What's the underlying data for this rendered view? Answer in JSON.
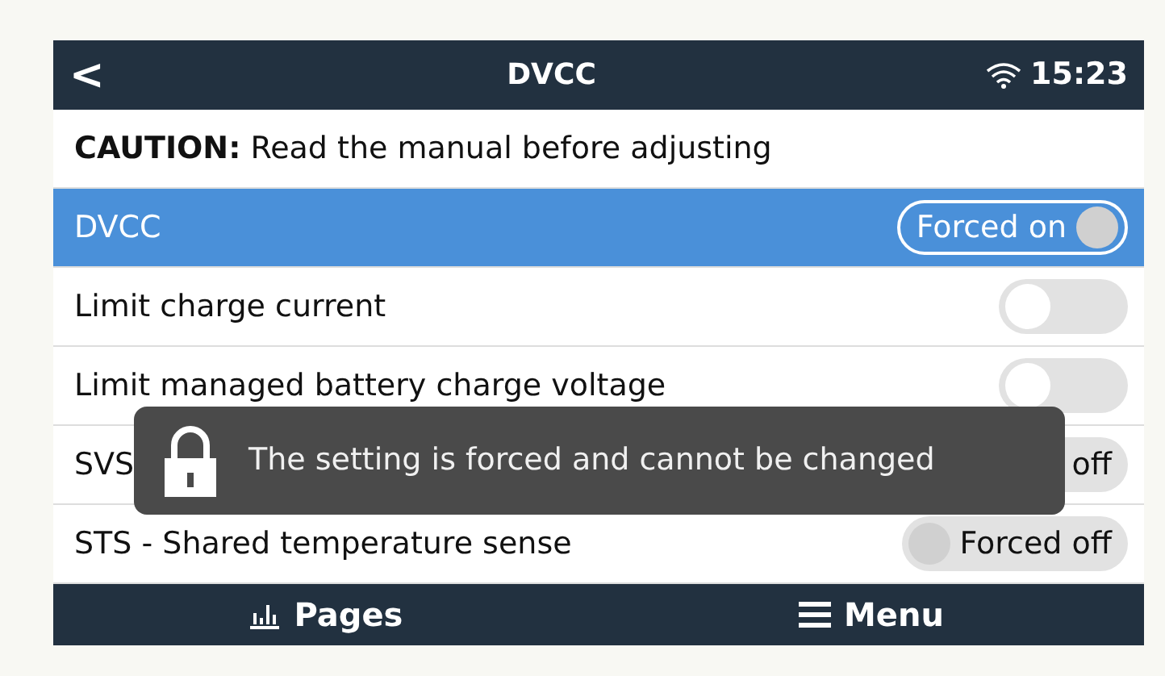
{
  "header": {
    "back": "<",
    "title": "DVCC",
    "time": "15:23"
  },
  "caution": "**CAUTION:** Read the manual before adjusting",
  "settings": [
    {
      "label": "DVCC",
      "selected": true,
      "control": {
        "kind": "forced",
        "on": true,
        "text": "Forced on"
      }
    },
    {
      "label": "Limit charge current",
      "selected": false,
      "control": {
        "kind": "switch",
        "on": false
      }
    },
    {
      "label": "Limit managed battery charge voltage",
      "selected": false,
      "control": {
        "kind": "switch",
        "on": false
      }
    },
    {
      "label": "SVS",
      "selected": false,
      "control": {
        "kind": "forced",
        "on": false,
        "text": "off"
      }
    },
    {
      "label": "STS - Shared temperature sense",
      "selected": false,
      "control": {
        "kind": "forced",
        "on": false,
        "text": "Forced off"
      }
    }
  ],
  "toast": {
    "text": "The setting is forced and cannot be changed"
  },
  "footer": [
    {
      "kind": "pages",
      "label": "Pages"
    },
    {
      "kind": "menu",
      "label": "Menu"
    }
  ]
}
